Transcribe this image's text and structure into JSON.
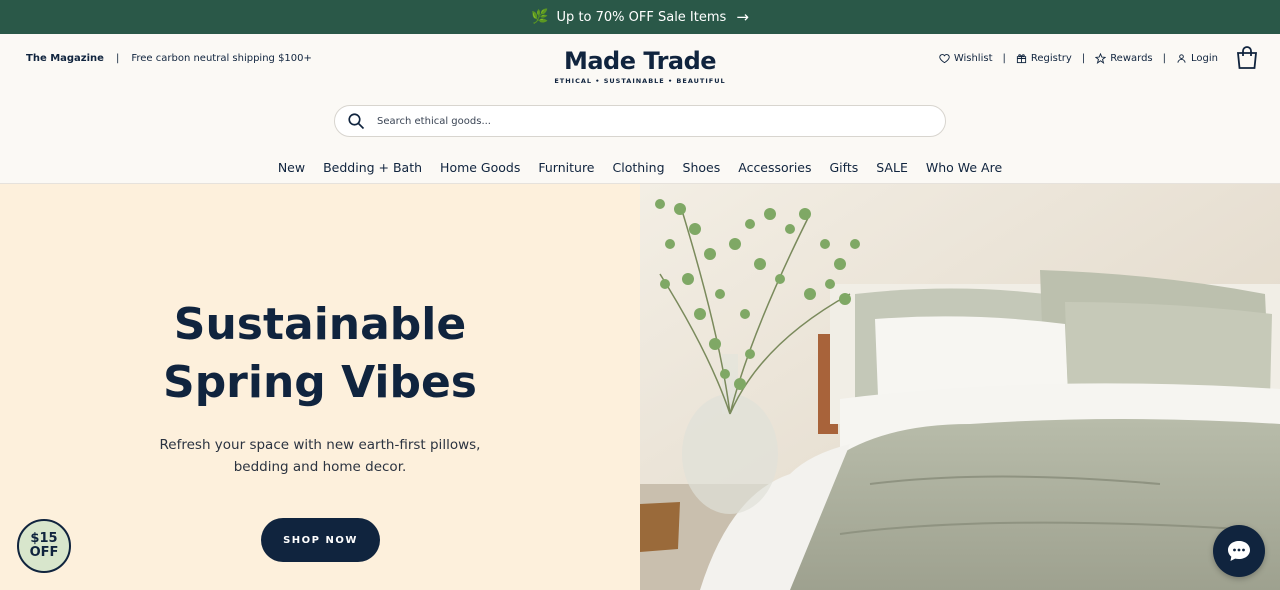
{
  "promo": {
    "text": "Up to 70% OFF Sale Items",
    "leaf_icon": "leaf-icon",
    "arrow_icon": "arrow-right-icon"
  },
  "header": {
    "magazine_link": "The Magazine",
    "separator": "|",
    "shipping_text": "Free carbon neutral shipping $100+",
    "logo_name": "Made Trade",
    "logo_tagline": "ETHICAL • SUSTAINABLE • BEAUTIFUL",
    "wishlist": "Wishlist",
    "registry": "Registry",
    "rewards": "Rewards",
    "login": "Login"
  },
  "search": {
    "placeholder": "Search ethical goods..."
  },
  "nav": {
    "items": [
      "New",
      "Bedding + Bath",
      "Home Goods",
      "Furniture",
      "Clothing",
      "Shoes",
      "Accessories",
      "Gifts",
      "SALE",
      "Who We Are"
    ]
  },
  "hero": {
    "title_line1": "Sustainable",
    "title_line2": "Spring Vibes",
    "subtitle_line1": "Refresh your space with new earth-first pillows,",
    "subtitle_line2": "bedding and home decor.",
    "cta": "SHOP NOW"
  },
  "discount_badge": {
    "line1": "$15",
    "line2": "OFF"
  },
  "colors": {
    "promo_bg": "#2a5848",
    "navy": "#10243e",
    "hero_left_bg": "#fdf0dc",
    "badge_bg": "#d8e6cc"
  }
}
